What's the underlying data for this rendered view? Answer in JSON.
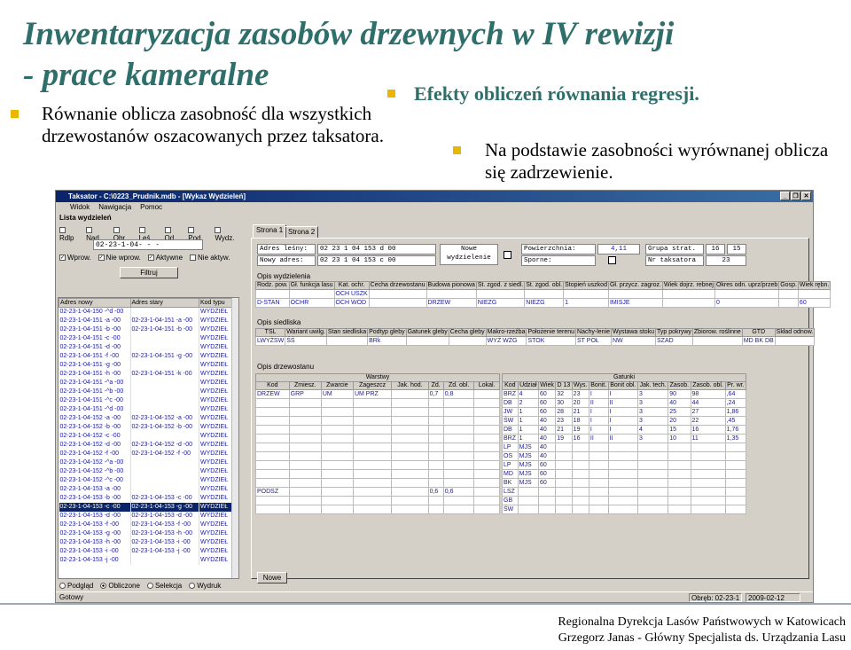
{
  "slide": {
    "title_line1": "Inwentaryzacja zasobów drzewnych w IV rewizji",
    "title_line2": "- prace kameralne",
    "bullet1": "Równanie oblicza zasobność dla wszystkich drzewostanów oszacowanych przez taksatora.",
    "subhead": "Efekty obliczeń równania regresji.",
    "bullet2": "Na podstawie zasobności wyrównanej oblicza się zadrzewienie.",
    "footer1": "Regionalna Dyrekcja Lasów Państwowych w Katowicach",
    "footer2": "Grzegorz Janas - Główny Specjalista ds. Urządzania Lasu",
    "bullet_color": "#e8b800",
    "title_color": "#2e6f6b"
  },
  "window": {
    "title": "Taksator - C:\\0223_Prudnik.mdb - [Wykaz Wydzieleń]",
    "menu": [
      "Widok",
      "Nawigacja",
      "Pomoc"
    ]
  },
  "left": {
    "group_title": "Lista wydzieleń",
    "filters": [
      "Rdlp",
      "Nad.",
      "Obr.",
      "Leś.",
      "Od.",
      "Pod.",
      "Wydz."
    ],
    "address": "02-23-1-04-  -  -",
    "checks": [
      "Wprow.",
      "Nie wprow.",
      "Aktywne",
      "Nie aktyw."
    ],
    "filter_button": "Filtruj",
    "columns": [
      "Adres nowy",
      "Adres stary",
      "Kod typu"
    ],
    "rows": [
      [
        "02-23-1-04-150 -^d -00",
        "",
        "WYDZIEŁ"
      ],
      [
        "02-23-1-04-151 -a -00",
        "02-23-1-04-151 -a -00",
        "WYDZIEŁ"
      ],
      [
        "02-23-1-04-151 -b -00",
        "02-23-1-04-151 -b -00",
        "WYDZIEŁ"
      ],
      [
        "02-23-1-04-151 -c -00",
        "",
        "WYDZIEŁ"
      ],
      [
        "02-23-1-04-151 -d -00",
        "",
        "WYDZIEŁ"
      ],
      [
        "02-23-1-04-151 -f -00",
        "02-23-1-04-151 -g -00",
        "WYDZIEŁ"
      ],
      [
        "02-23-1-04-151 -g -00",
        "",
        "WYDZIEŁ"
      ],
      [
        "02-23-1-04-151 -h -00",
        "02-23-1-04-151 -k -00",
        "WYDZIEŁ"
      ],
      [
        "02-23-1-04-151 -^a -00",
        "",
        "WYDZIEŁ"
      ],
      [
        "02-23-1-04-151 -^b -00",
        "",
        "WYDZIEŁ"
      ],
      [
        "02-23-1-04-151 -^c -00",
        "",
        "WYDZIEŁ"
      ],
      [
        "02-23-1-04-151 -^d -00",
        "",
        "WYDZIEŁ"
      ],
      [
        "02-23-1-04-152 -a -00",
        "02-23-1-04-152 -a -00",
        "WYDZIEŁ"
      ],
      [
        "02-23-1-04-152 -b -00",
        "02-23-1-04-152 -b -00",
        "WYDZIEŁ"
      ],
      [
        "02-23-1-04-152 -c -00",
        "",
        "WYDZIEŁ"
      ],
      [
        "02-23-1-04-152 -d -00",
        "02-23-1-04-152 -d -00",
        "WYDZIEŁ"
      ],
      [
        "02-23-1-04-152 -f -00",
        "02-23-1-04-152 -f -00",
        "WYDZIEŁ"
      ],
      [
        "02-23-1-04-152 -^a -00",
        "",
        "WYDZIEŁ"
      ],
      [
        "02-23-1-04-152 -^b -00",
        "",
        "WYDZIEŁ"
      ],
      [
        "02-23-1-04-152 -^c -00",
        "",
        "WYDZIEŁ"
      ],
      [
        "02-23-1-04-153 -a -00",
        "",
        "WYDZIEŁ"
      ],
      [
        "02-23-1-04-153 -b -00",
        "02-23-1-04-153 -c -00",
        "WYDZIEŁ"
      ],
      [
        "02-23-1-04-153 -c -00",
        "02-23-1-04-153 -g -00",
        "WYDZIEŁ"
      ],
      [
        "02-23-1-04-153 -d -00",
        "02-23-1-04-153 -d -00",
        "WYDZIEŁ"
      ],
      [
        "02-23-1-04-153 -f -00",
        "02-23-1-04-153 -f -00",
        "WYDZIEŁ"
      ],
      [
        "02-23-1-04-153 -g -00",
        "02-23-1-04-153 -h -00",
        "WYDZIEŁ"
      ],
      [
        "02-23-1-04-153 -h -00",
        "02-23-1-04-153 -i -00",
        "WYDZIEŁ"
      ],
      [
        "02-23-1-04-153 -i -00",
        "02-23-1-04-153 -j -00",
        "WYDZIEŁ"
      ],
      [
        "02-23-1-04-153 -j -00",
        "",
        "WYDZIEŁ"
      ]
    ],
    "selected_row": 22,
    "radios": [
      "Podgląd",
      "Obliczone",
      "Selekcja",
      "Wydruk"
    ],
    "radio_selected": 1
  },
  "right": {
    "tabs": [
      "Strona 1",
      "Strona 2"
    ],
    "hdr": {
      "adres_lesny_label": "Adres leśny:",
      "adres_lesny": "02  23  1  04  153  d  00",
      "nowy_adres_label": "Nowy adres:",
      "nowy_adres": "02  23  1  04  153  c  00",
      "nowe_label": "Nowe",
      "nowe2": "wydzielenie",
      "pow_label": "Powierzchnia:",
      "pow": "4,11",
      "sporne_label": "Sporne:",
      "grupa_label": "Grupa strat.",
      "grupa1": "16",
      "grupa2": "15",
      "nr_label": "Nr taksatora",
      "nr": "23"
    },
    "sec1": "Opis wydzielenia",
    "t1h": [
      "Rodz. pow.",
      "Gł. funkcja lasu",
      "Kat. ochr.",
      "Cecha drzewostanu",
      "Budowa pionowa",
      "St. zgod. z siedl.",
      "St. zgod. obl.",
      "Stopień uszkod",
      "Gł. przycz. zagroz.",
      "Wiek dojrz. rebnej",
      "Okres odn. uprz/przeb",
      "Gosp.",
      "Wiek rębn."
    ],
    "t1r1": [
      "",
      "",
      "OCH USZK",
      "",
      "",
      "",
      "",
      "",
      "",
      "",
      "",
      "",
      ""
    ],
    "t1r2": [
      "D-STAN",
      "OCHR",
      "OCH WOD",
      "",
      "DRZEW",
      "NIEZG",
      "NIEZG",
      "1",
      "IMISJE",
      "",
      "0",
      "",
      "60"
    ],
    "sec2": "Opis siedliska",
    "t2h": [
      "TSL",
      "Wariant uwilg.",
      "Stan siedliska",
      "Podtyp gleby",
      "Gatunek gleby",
      "Cecha gleby",
      "Makro-rzeźba",
      "Położenie terenu",
      "Nachy-lenie",
      "Wystawa stoku",
      "Typ pokrywy",
      "Zbiorow. roślinne",
      "GTD",
      "Skład odnow."
    ],
    "t2r": [
      "LWYŻSW",
      "ŚŚ",
      "",
      "BRk",
      "",
      "",
      "WYŻ WZG",
      "STOK",
      "ST POŁ",
      "NW",
      "SZAD",
      "",
      "MD BK DB",
      ""
    ],
    "sec3": "Opis drzewostanu",
    "warstwy": "Warstwy",
    "gatunki": "Gatunki",
    "wh": [
      "Kod",
      "Zmiesz.",
      "Zwarcie",
      "Zageszcz",
      "Jak. hod.",
      "Zd.",
      "Zd. obl.",
      "Lokal."
    ],
    "wr": [
      [
        "DRZEW",
        "GRP",
        "UM",
        "UM PRZ",
        "",
        "0,7",
        "0,8",
        ""
      ],
      [
        "PODSZ",
        "",
        "",
        "",
        "",
        "0,6",
        "0,6",
        ""
      ]
    ],
    "gh": [
      "Kod",
      "Udział",
      "Wiek",
      "D 13",
      "Wys.",
      "Bonit.",
      "Bonit obl.",
      "Jak. tech.",
      "Zasob.",
      "Zasob. obl.",
      "Pr. wr."
    ],
    "gr": [
      [
        "BRZ",
        "4",
        "60",
        "32",
        "23",
        "I",
        "I",
        "3",
        "90",
        "98",
        ",64"
      ],
      [
        "DB",
        "2",
        "60",
        "30",
        "20",
        "II",
        "II",
        "3",
        "40",
        "44",
        ",24"
      ],
      [
        "JW",
        "1",
        "60",
        "28",
        "21",
        "I",
        "I",
        "3",
        "25",
        "27",
        "1,86"
      ],
      [
        "ŚW",
        "1",
        "40",
        "23",
        "18",
        "I",
        "I",
        "3",
        "20",
        "22",
        ",45"
      ],
      [
        "DB",
        "1",
        "40",
        "21",
        "19",
        "I",
        "I",
        "4",
        "15",
        "16",
        "1,76"
      ],
      [
        "BRZ",
        "1",
        "40",
        "19",
        "16",
        "II",
        "II",
        "3",
        "10",
        "11",
        "1,35"
      ],
      [
        "LP",
        "MJS",
        "40",
        "",
        "",
        "",
        "",
        "",
        "",
        "",
        ""
      ],
      [
        "OS",
        "MJS",
        "40",
        "",
        "",
        "",
        "",
        "",
        "",
        "",
        ""
      ],
      [
        "LP",
        "MJS",
        "60",
        "",
        "",
        "",
        "",
        "",
        "",
        "",
        ""
      ],
      [
        "MD",
        "MJS",
        "60",
        "",
        "",
        "",
        "",
        "",
        "",
        "",
        ""
      ],
      [
        "BK",
        "MJS",
        "60",
        "",
        "",
        "",
        "",
        "",
        "",
        "",
        ""
      ],
      [
        "LSZ",
        "",
        "",
        "",
        "",
        "",
        "",
        "",
        "",
        "",
        ""
      ],
      [
        "GB",
        "",
        "",
        "",
        "",
        "",
        "",
        "",
        "",
        "",
        ""
      ],
      [
        "ŚW",
        "",
        "",
        "",
        "",
        "",
        "",
        "",
        "",
        "",
        ""
      ]
    ],
    "nowe_button": "Nowe"
  },
  "status": {
    "left": "Gotowy",
    "obreb": "Obręb: 02-23-1",
    "date": "2009-02-12"
  }
}
